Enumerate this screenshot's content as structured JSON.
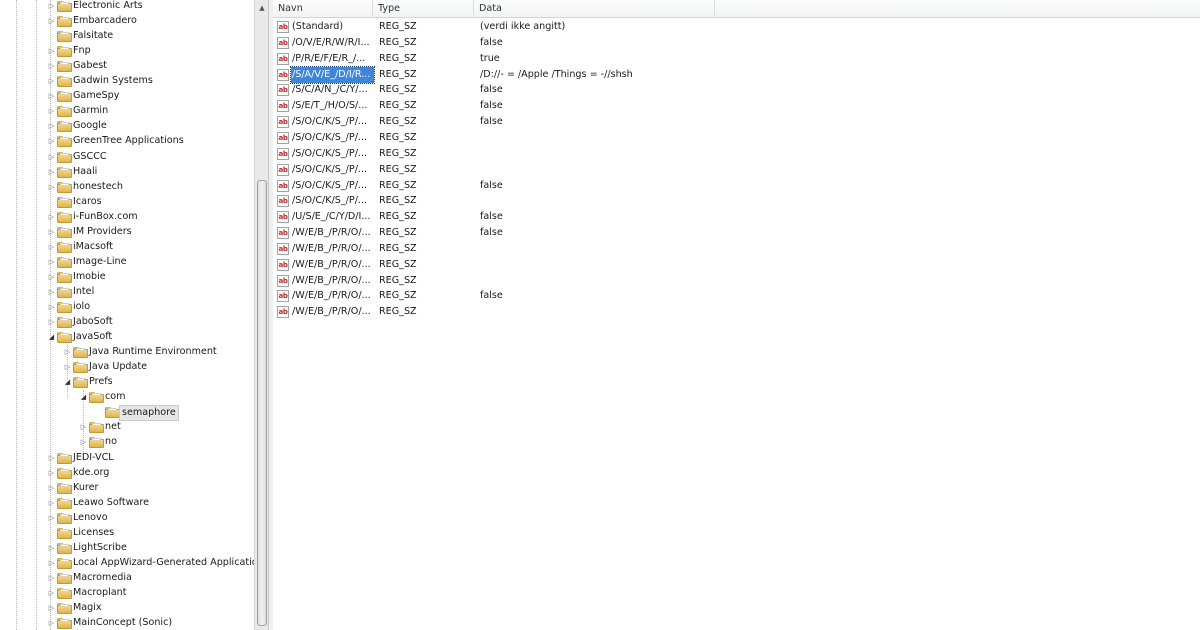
{
  "tree": {
    "items": [
      {
        "label": "Electronic Arts",
        "level": 0,
        "toggle": "collapsed"
      },
      {
        "label": "Embarcadero",
        "level": 0,
        "toggle": "collapsed"
      },
      {
        "label": "Falsitate",
        "level": 0,
        "toggle": "none"
      },
      {
        "label": "Fnp",
        "level": 0,
        "toggle": "collapsed"
      },
      {
        "label": "Gabest",
        "level": 0,
        "toggle": "collapsed"
      },
      {
        "label": "Gadwin Systems",
        "level": 0,
        "toggle": "collapsed"
      },
      {
        "label": "GameSpy",
        "level": 0,
        "toggle": "collapsed"
      },
      {
        "label": "Garmin",
        "level": 0,
        "toggle": "collapsed"
      },
      {
        "label": "Google",
        "level": 0,
        "toggle": "collapsed"
      },
      {
        "label": "GreenTree Applications",
        "level": 0,
        "toggle": "collapsed"
      },
      {
        "label": "GSCCC",
        "level": 0,
        "toggle": "collapsed"
      },
      {
        "label": "Haali",
        "level": 0,
        "toggle": "collapsed"
      },
      {
        "label": "honestech",
        "level": 0,
        "toggle": "collapsed"
      },
      {
        "label": "Icaros",
        "level": 0,
        "toggle": "none"
      },
      {
        "label": "i-FunBox.com",
        "level": 0,
        "toggle": "collapsed"
      },
      {
        "label": "IM Providers",
        "level": 0,
        "toggle": "collapsed"
      },
      {
        "label": "iMacsoft",
        "level": 0,
        "toggle": "collapsed"
      },
      {
        "label": "Image-Line",
        "level": 0,
        "toggle": "collapsed"
      },
      {
        "label": "Imobie",
        "level": 0,
        "toggle": "collapsed"
      },
      {
        "label": "Intel",
        "level": 0,
        "toggle": "collapsed"
      },
      {
        "label": "iolo",
        "level": 0,
        "toggle": "collapsed"
      },
      {
        "label": "JaboSoft",
        "level": 0,
        "toggle": "collapsed"
      },
      {
        "label": "JavaSoft",
        "level": 0,
        "toggle": "expanded"
      },
      {
        "label": "Java Runtime Environment",
        "level": 1,
        "toggle": "collapsed"
      },
      {
        "label": "Java Update",
        "level": 1,
        "toggle": "collapsed"
      },
      {
        "label": "Prefs",
        "level": 1,
        "toggle": "expanded"
      },
      {
        "label": "com",
        "level": 2,
        "toggle": "expanded"
      },
      {
        "label": "semaphore",
        "level": 3,
        "toggle": "none",
        "selected": true
      },
      {
        "label": "net",
        "level": 2,
        "toggle": "collapsed"
      },
      {
        "label": "no",
        "level": 2,
        "toggle": "collapsed"
      },
      {
        "label": "JEDI-VCL",
        "level": 0,
        "toggle": "collapsed"
      },
      {
        "label": "kde.org",
        "level": 0,
        "toggle": "collapsed"
      },
      {
        "label": "Kurer",
        "level": 0,
        "toggle": "collapsed"
      },
      {
        "label": "Leawo Software",
        "level": 0,
        "toggle": "collapsed"
      },
      {
        "label": "Lenovo",
        "level": 0,
        "toggle": "collapsed"
      },
      {
        "label": "Licenses",
        "level": 0,
        "toggle": "none"
      },
      {
        "label": "LightScribe",
        "level": 0,
        "toggle": "collapsed"
      },
      {
        "label": "Local AppWizard-Generated Applications",
        "level": 0,
        "toggle": "collapsed"
      },
      {
        "label": "Macromedia",
        "level": 0,
        "toggle": "collapsed"
      },
      {
        "label": "Macroplant",
        "level": 0,
        "toggle": "collapsed"
      },
      {
        "label": "Magix",
        "level": 0,
        "toggle": "collapsed"
      },
      {
        "label": "MainConcept (Sonic)",
        "level": 0,
        "toggle": "collapsed"
      }
    ]
  },
  "scrollbar": {
    "up_icon": "scroll-up-arrow-icon"
  },
  "list": {
    "columns": {
      "name": "Navn",
      "type": "Type",
      "data": "Data"
    },
    "value_icon": "ab",
    "rows": [
      {
        "name": "(Standard)",
        "type": "REG_SZ",
        "data": "(verdi ikke angitt)"
      },
      {
        "name": "/O/V/E/R/W/R/I...",
        "type": "REG_SZ",
        "data": "false"
      },
      {
        "name": "/P/R/E/F/E/R_/...",
        "type": "REG_SZ",
        "data": "true"
      },
      {
        "name": "/S/A/V/E_/D/I/R...",
        "type": "REG_SZ",
        "data": "/D://- = /Apple /Things = -//shsh",
        "selected": true
      },
      {
        "name": "/S/C/A/N_/C/Y/...",
        "type": "REG_SZ",
        "data": "false"
      },
      {
        "name": "/S/E/T_/H/O/S/...",
        "type": "REG_SZ",
        "data": "false"
      },
      {
        "name": "/S/O/C/K/S_/P/...",
        "type": "REG_SZ",
        "data": "false"
      },
      {
        "name": "/S/O/C/K/S_/P/...",
        "type": "REG_SZ",
        "data": ""
      },
      {
        "name": "/S/O/C/K/S_/P/...",
        "type": "REG_SZ",
        "data": ""
      },
      {
        "name": "/S/O/C/K/S_/P/...",
        "type": "REG_SZ",
        "data": ""
      },
      {
        "name": "/S/O/C/K/S_/P/...",
        "type": "REG_SZ",
        "data": "false"
      },
      {
        "name": "/S/O/C/K/S_/P/...",
        "type": "REG_SZ",
        "data": ""
      },
      {
        "name": "/U/S/E_/C/Y/D/I...",
        "type": "REG_SZ",
        "data": "false"
      },
      {
        "name": "/W/E/B_/P/R/O/...",
        "type": "REG_SZ",
        "data": "false"
      },
      {
        "name": "/W/E/B_/P/R/O/...",
        "type": "REG_SZ",
        "data": ""
      },
      {
        "name": "/W/E/B_/P/R/O/...",
        "type": "REG_SZ",
        "data": ""
      },
      {
        "name": "/W/E/B_/P/R/O/...",
        "type": "REG_SZ",
        "data": ""
      },
      {
        "name": "/W/E/B_/P/R/O/...",
        "type": "REG_SZ",
        "data": "false"
      },
      {
        "name": "/W/E/B_/P/R/O/...",
        "type": "REG_SZ",
        "data": ""
      }
    ]
  }
}
